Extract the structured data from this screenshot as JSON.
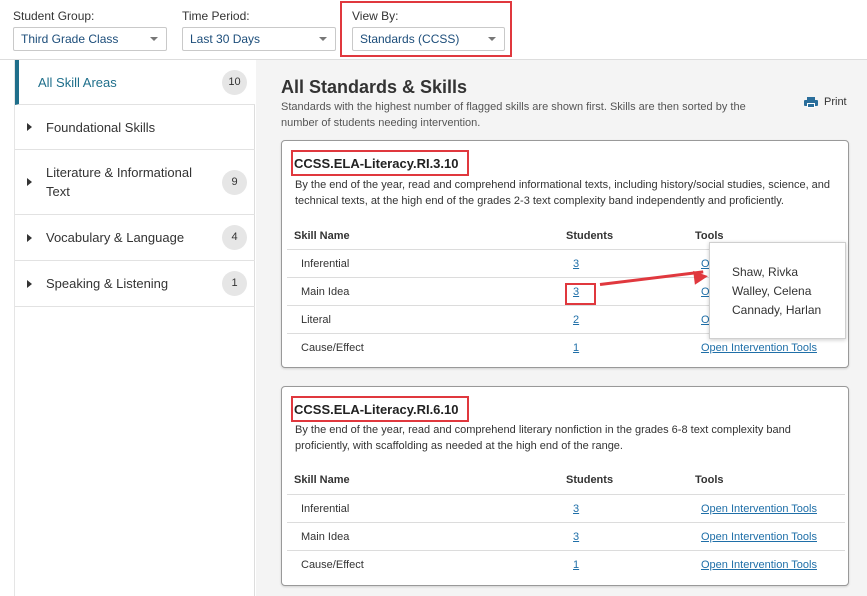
{
  "filters": {
    "student_group": {
      "label": "Student Group:",
      "value": "Third Grade Class"
    },
    "time_period": {
      "label": "Time Period:",
      "value": "Last 30 Days"
    },
    "view_by": {
      "label": "View By:",
      "value": "Standards (CCSS)"
    }
  },
  "sidebar": {
    "items": [
      {
        "label": "All Skill Areas",
        "count": "10"
      },
      {
        "label": "Foundational Skills",
        "count": ""
      },
      {
        "label": "Literature & Informational Text",
        "count": "9"
      },
      {
        "label": "Vocabulary & Language",
        "count": "4"
      },
      {
        "label": "Speaking & Listening",
        "count": "1"
      }
    ]
  },
  "main": {
    "title": "All Standards & Skills",
    "description": "Standards with the highest number of flagged skills are shown first. Skills are then sorted by the number of students needing intervention.",
    "print_label": "Print",
    "columns": {
      "skill": "Skill Name",
      "students": "Students",
      "tools": "Tools"
    },
    "cards": [
      {
        "standard": "CCSS.ELA-Literacy.RI.3.10",
        "description": "By the end of the year, read and comprehend informational texts, including history/social studies, science, and technical texts, at the high end of the grades 2-3 text complexity band independently and proficiently.",
        "rows": [
          {
            "skill": "Inferential",
            "students": "3",
            "tools": "O"
          },
          {
            "skill": "Main Idea",
            "students": "3",
            "tools": "O"
          },
          {
            "skill": "Literal",
            "students": "2",
            "tools": "O"
          },
          {
            "skill": "Cause/Effect",
            "students": "1",
            "tools": "Open Intervention Tools"
          }
        ]
      },
      {
        "standard": "CCSS.ELA-Literacy.RI.6.10",
        "description": "By the end of the year, read and comprehend literary nonfiction in the grades 6-8 text complexity band proficiently, with scaffolding as needed at the high end of the range.",
        "rows": [
          {
            "skill": "Inferential",
            "students": "3",
            "tools": "Open Intervention Tools"
          },
          {
            "skill": "Main Idea",
            "students": "3",
            "tools": "Open Intervention Tools"
          },
          {
            "skill": "Cause/Effect",
            "students": "1",
            "tools": "Open Intervention Tools"
          }
        ]
      }
    ]
  },
  "tooltip": {
    "names": [
      "Shaw, Rivka",
      "Walley, Celena",
      "Cannady, Harlan"
    ]
  },
  "colors": {
    "accent": "#1f6f8b",
    "link": "#1f6fa8",
    "highlight": "#e0383e"
  }
}
